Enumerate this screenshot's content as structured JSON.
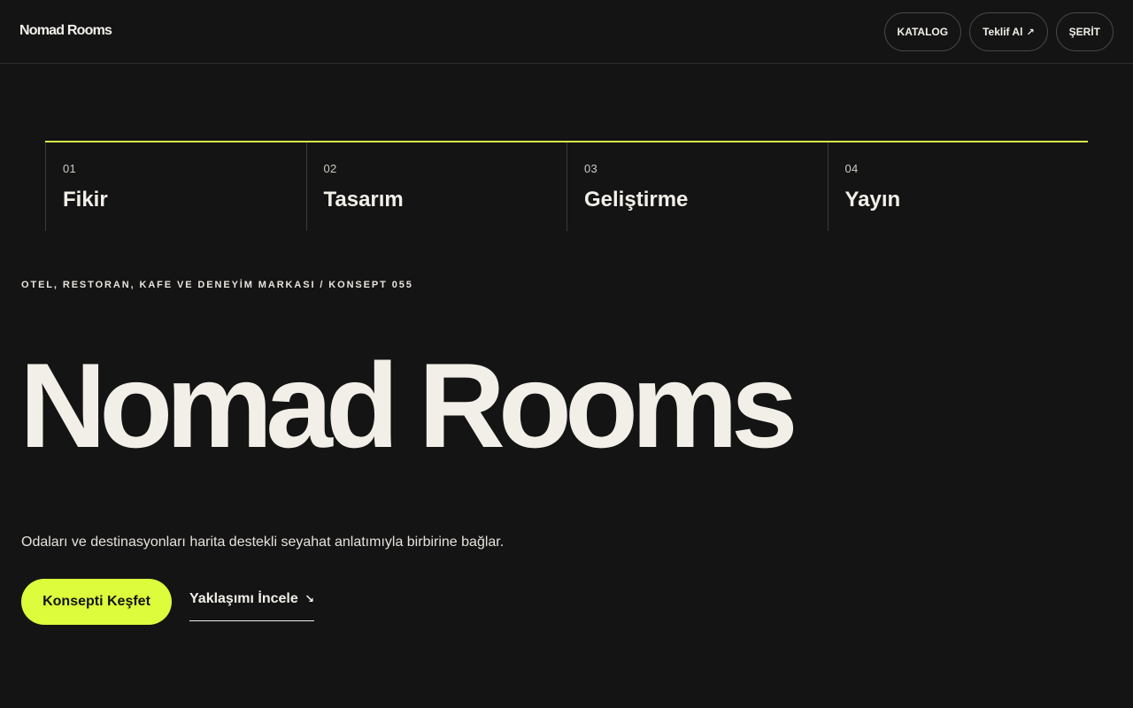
{
  "header": {
    "logo": "Nomad Rooms",
    "nav": [
      {
        "label": "KATALOG"
      },
      {
        "label": "Teklif Al",
        "icon": "arrow-up-right-icon",
        "glyph": "↗"
      },
      {
        "label": "ŞERİT"
      }
    ]
  },
  "steps": [
    {
      "num": "01",
      "title": "Fikir"
    },
    {
      "num": "02",
      "title": "Tasarım"
    },
    {
      "num": "03",
      "title": "Geliştirme"
    },
    {
      "num": "04",
      "title": "Yayın"
    }
  ],
  "hero": {
    "eyebrow": "OTEL, RESTORAN, KAFE VE DENEYİM MARKASI / KONSEPT 055",
    "title": "Nomad Rooms",
    "lead": "Odaları ve destinasyonları harita destekli seyahat anlatımıyla birbirine bağlar.",
    "cta_label": "Konsepti Keşfet",
    "secondary_label": "Yaklaşımı İncele",
    "secondary_icon": "arrow-down-right-icon",
    "secondary_glyph": "↘"
  },
  "colors": {
    "background": "#141414",
    "accent": "#dcfc3c",
    "text": "#f2efe9"
  }
}
